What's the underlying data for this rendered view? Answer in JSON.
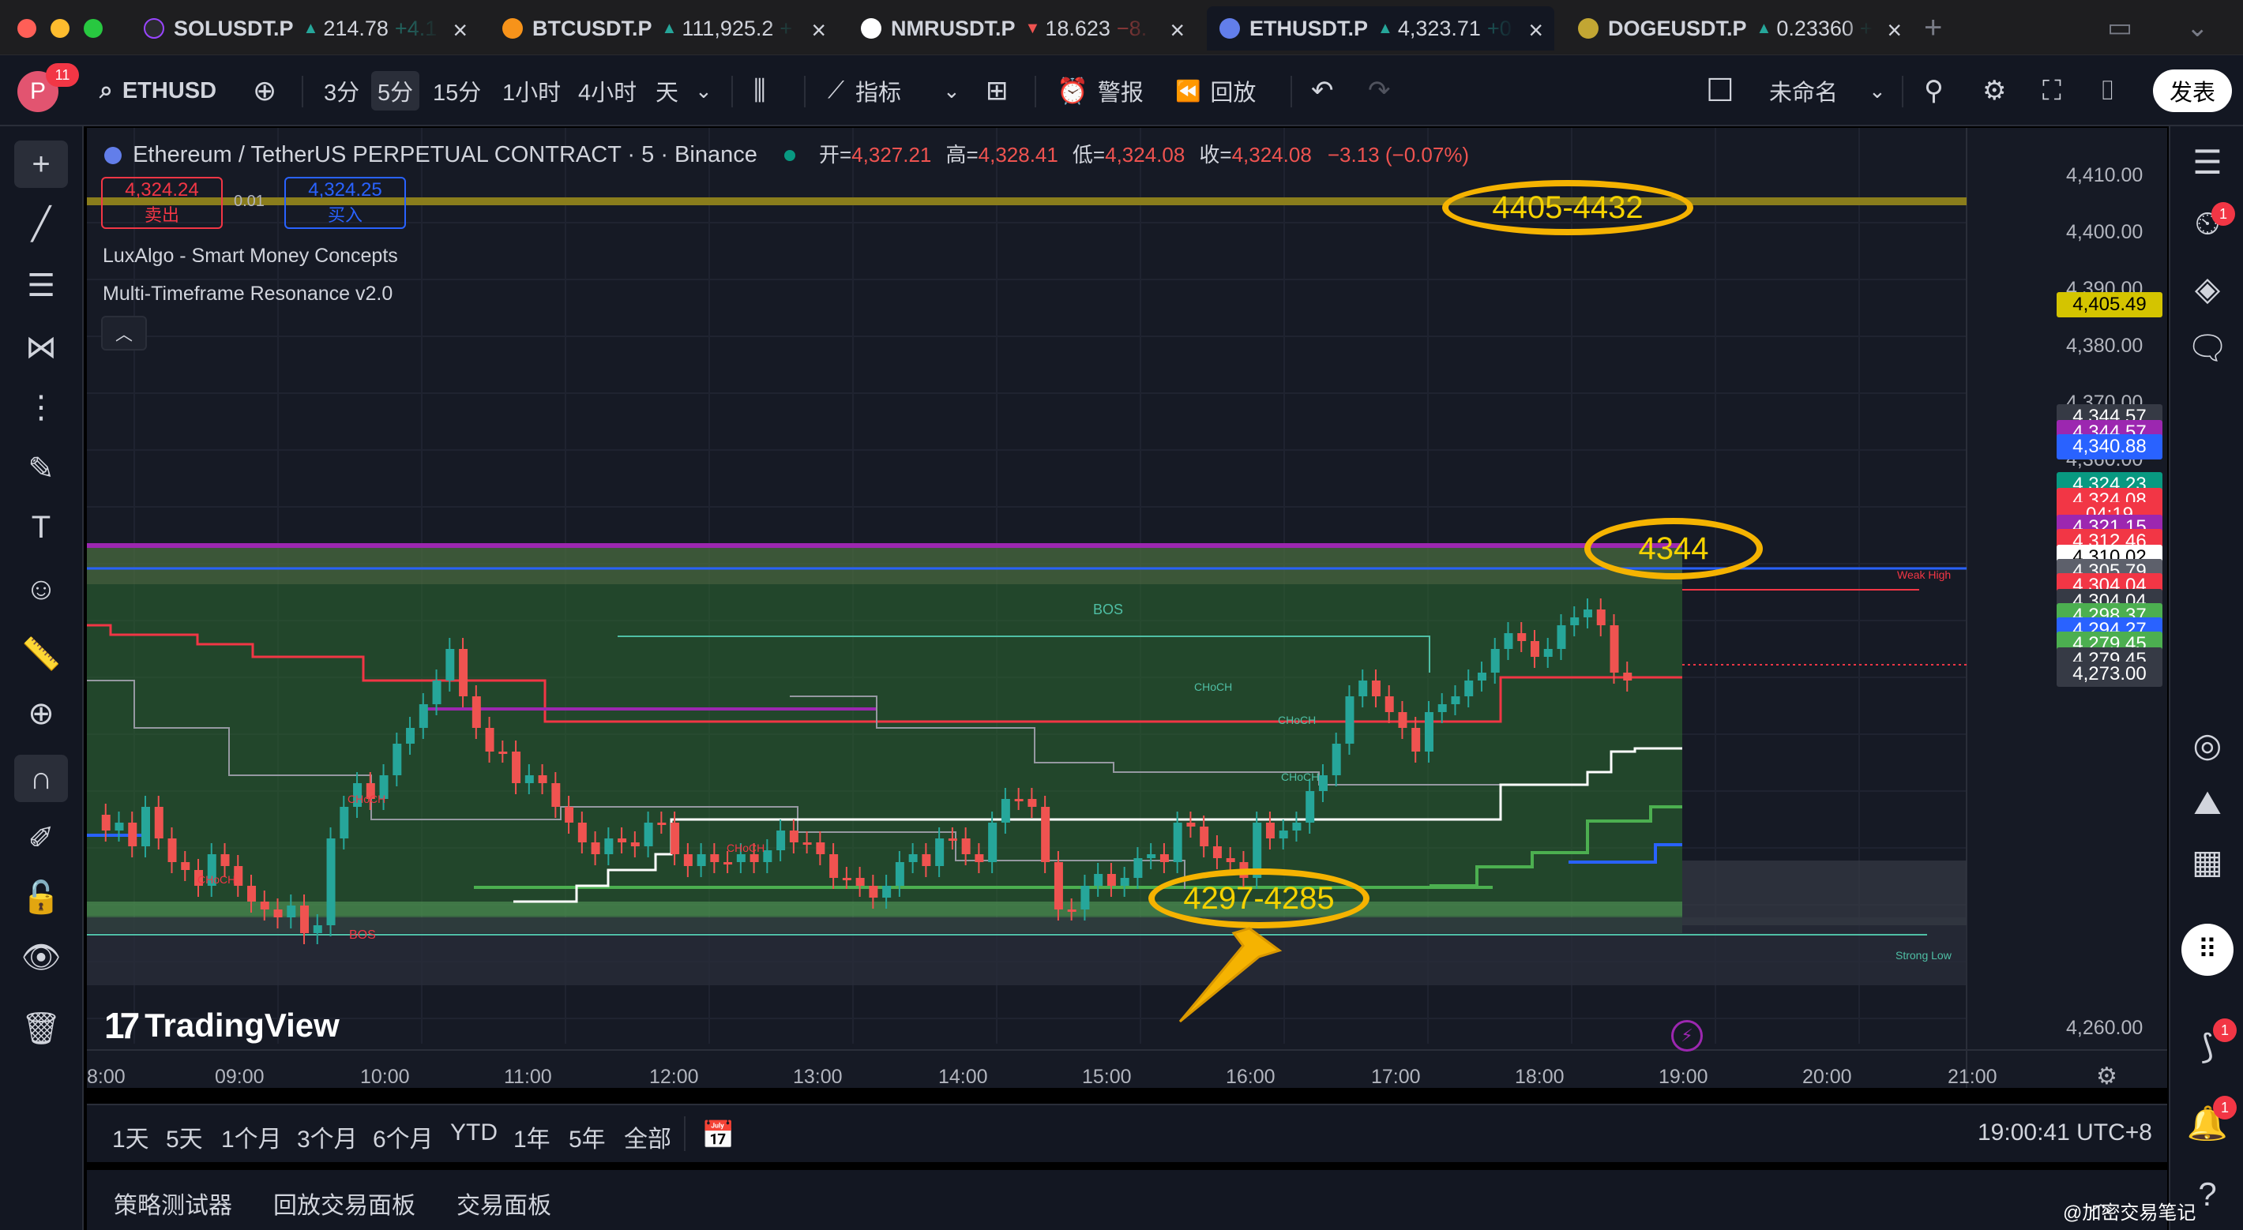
{
  "window": {
    "tabs": [
      {
        "symbol": "SOLUSDT.P",
        "dir": "up",
        "price": "214.78",
        "change": "+4.1",
        "coin_color": "#2b2b30",
        "active": false
      },
      {
        "symbol": "BTCUSDT.P",
        "dir": "up",
        "price": "111,925.2",
        "change": "+",
        "coin_color": "#f7931a",
        "active": false
      },
      {
        "symbol": "NMRUSDT.P",
        "dir": "down",
        "price": "18.623",
        "change": "−8.",
        "coin_color": "#ffffff",
        "active": false
      },
      {
        "symbol": "ETHUSDT.P",
        "dir": "up",
        "price": "4,323.71",
        "change": "+0",
        "coin_color": "#627eea",
        "active": true
      },
      {
        "symbol": "DOGEUSDT.P",
        "dir": "up",
        "price": "0.23360",
        "change": "+",
        "coin_color": "#c2a633",
        "active": false
      }
    ],
    "new_tab": "+"
  },
  "toolbar": {
    "avatar_letter": "P",
    "avatar_badge": "11",
    "symbol": "ETHUSD",
    "intervals": [
      "3分",
      "5分",
      "15分",
      "1小时",
      "4小时",
      "天"
    ],
    "selected_interval": "5分",
    "indicators_label": "指标",
    "alert_label": "警报",
    "replay_label": "回放",
    "layout_name": "未命名",
    "publish_label": "发表"
  },
  "chart": {
    "title": "Ethereum / TetherUS PERPETUAL CONTRACT · 5 · Binance",
    "ohlc": {
      "o_label": "开=",
      "o": "4,327.21",
      "h_label": "高=",
      "h": "4,328.41",
      "l_label": "低=",
      "l": "4,324.08",
      "c_label": "收=",
      "c": "4,324.08",
      "change": "−3.13 (−0.07%)"
    },
    "sell": {
      "price": "4,324.24",
      "label": "卖出"
    },
    "spread": "0.01",
    "buy": {
      "price": "4,324.25",
      "label": "买入"
    },
    "indicators": [
      "LuxAlgo - Smart Money Concepts",
      "Multi-Timeframe Resonance v2.0"
    ],
    "watermark": "TradingView",
    "y_ticks": [
      "4,410.00",
      "4,400.00",
      "4,390.00",
      "4,380.00",
      "4,370.00",
      "4,360.00",
      "4,260.00"
    ],
    "x_ticks": [
      "8:00",
      "09:00",
      "10:00",
      "11:00",
      "12:00",
      "13:00",
      "14:00",
      "15:00",
      "16:00",
      "17:00",
      "18:00",
      "19:00",
      "20:00",
      "21:00"
    ],
    "price_labels": [
      {
        "text": "4,405.49",
        "bg": "#d4c400",
        "fg": "#000000"
      },
      {
        "text": "4,344.57",
        "bg": "#363a45",
        "fg": "#ffffff"
      },
      {
        "text": "4,344.57",
        "bg": "#9c27b0",
        "fg": "#ffffff"
      },
      {
        "text": "4,340.88",
        "bg": "#2962ff",
        "fg": "#ffffff"
      },
      {
        "text": "4,324.23",
        "bg": "#089981",
        "fg": "#ffffff"
      },
      {
        "text": "4,324.08",
        "bg": "#f23645",
        "fg": "#ffffff"
      },
      {
        "text": "04:19",
        "bg": "#f23645",
        "fg": "#ffffff"
      },
      {
        "text": "4,321.15",
        "bg": "#9c27b0",
        "fg": "#ffffff"
      },
      {
        "text": "4,312.46",
        "bg": "#f23645",
        "fg": "#ffffff"
      },
      {
        "text": "4,310.02",
        "bg": "#ffffff",
        "fg": "#000000"
      },
      {
        "text": "4,305.79",
        "bg": "#5d606b",
        "fg": "#ffffff"
      },
      {
        "text": "4,304.04",
        "bg": "#f23645",
        "fg": "#ffffff"
      },
      {
        "text": "4,304.04",
        "bg": "#363a45",
        "fg": "#ffffff"
      },
      {
        "text": "4,298.37",
        "bg": "#4caf50",
        "fg": "#ffffff"
      },
      {
        "text": "4,294.27",
        "bg": "#2962ff",
        "fg": "#ffffff"
      },
      {
        "text": "4,279.45",
        "bg": "#4caf50",
        "fg": "#ffffff"
      },
      {
        "text": "4,279.45",
        "bg": "#363a45",
        "fg": "#ffffff"
      },
      {
        "text": "4,273.00",
        "bg": "#363a45",
        "fg": "#ffffff"
      }
    ],
    "annotations": {
      "top_zone": "4405-4432",
      "resistance": "4344",
      "support": "4297-4285"
    },
    "smc_labels": {
      "bos_top": "BOS",
      "bos_bottom": "BOS",
      "choch": "CHoCH",
      "weak_high": "Weak High",
      "strong_low": "Strong Low"
    }
  },
  "rangebar": {
    "ranges": [
      "1天",
      "5天",
      "1个月",
      "3个月",
      "6个月",
      "YTD",
      "1年",
      "5年",
      "全部"
    ],
    "clock": "19:00:41 UTC+8"
  },
  "panel_tabs": [
    "策略测试器",
    "回放交易面板",
    "交易面板"
  ],
  "right_badges": {
    "alerts": "1",
    "notifications": "1",
    "stream": "1"
  },
  "corner_watermark": "@加密交易笔记"
}
